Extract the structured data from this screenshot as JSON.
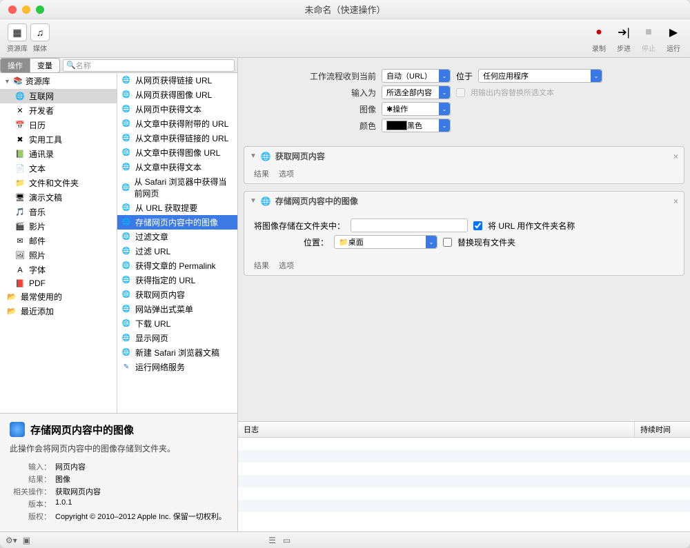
{
  "window": {
    "title": "未命名（快速操作）"
  },
  "toolbar": {
    "library": "资源库",
    "media": "媒体",
    "record": "录制",
    "step": "步进",
    "stop": "停止",
    "run": "运行"
  },
  "tabs": {
    "actions": "操作",
    "variables": "变量",
    "search_placeholder": "名称"
  },
  "library": {
    "root": "资源库",
    "categories": [
      {
        "label": "互联网",
        "icon": "🌐",
        "selected": true
      },
      {
        "label": "开发者",
        "icon": "✕"
      },
      {
        "label": "日历",
        "icon": "📅"
      },
      {
        "label": "实用工具",
        "icon": "✖"
      },
      {
        "label": "通讯录",
        "icon": "📗"
      },
      {
        "label": "文本",
        "icon": "📄"
      },
      {
        "label": "文件和文件夹",
        "icon": "📁"
      },
      {
        "label": "演示文稿",
        "icon": "🖥"
      },
      {
        "label": "音乐",
        "icon": "🎵"
      },
      {
        "label": "影片",
        "icon": "🎬"
      },
      {
        "label": "邮件",
        "icon": "✉"
      },
      {
        "label": "照片",
        "icon": "🖼"
      },
      {
        "label": "字体",
        "icon": "A"
      },
      {
        "label": "PDF",
        "icon": "📕"
      }
    ],
    "extras": [
      {
        "label": "最常使用的",
        "icon": "📂"
      },
      {
        "label": "最近添加",
        "icon": "📂"
      }
    ]
  },
  "actions": [
    "从网页获得链接 URL",
    "从网页获得图像 URL",
    "从网页中获得文本",
    "从文章中获得附带的 URL",
    "从文章中获得链接的 URL",
    "从文章中获得图像 URL",
    "从文章中获得文本",
    "从 Safari 浏览器中获得当前网页",
    "从 URL 获取提要",
    "存储网页内容中的图像",
    "过滤文章",
    "过滤 URL",
    "获得文章的 Permalink",
    "获得指定的 URL",
    "获取网页内容",
    "网站弹出式菜单",
    "下载 URL",
    "显示网页",
    "新建 Safari 浏览器文稿",
    "运行网络服务"
  ],
  "selected_action_index": 9,
  "detail": {
    "title": "存储网页内容中的图像",
    "description": "此操作会将网页内容中的图像存储到文件夹。",
    "kv": {
      "input_k": "输入：",
      "input_v": "网页内容",
      "result_k": "结果：",
      "result_v": "图像",
      "related_k": "相关操作：",
      "related_v": "获取网页内容",
      "version_k": "版本：",
      "version_v": "1.0.1",
      "copyright_k": "版权：",
      "copyright_v": "Copyright © 2010–2012 Apple Inc. 保留一切权利。"
    }
  },
  "config": {
    "workflow_receives": "工作流程收到当前",
    "workflow_receives_val": "自动（URL）",
    "located_in": "位于",
    "located_in_val": "任何应用程序",
    "input_as": "输入为",
    "input_as_val": "所选全部内容",
    "replace_label": "用输出内容替换所选文本",
    "image": "图像",
    "image_val": "操作",
    "color": "颜色",
    "color_val": "黑色"
  },
  "step1": {
    "title": "获取网页内容",
    "result": "结果",
    "options": "选项"
  },
  "step2": {
    "title": "存储网页内容中的图像",
    "save_in": "将图像存储在文件夹中：",
    "use_url_as_folder": "将 URL 用作文件夹名称",
    "location": "位置：",
    "location_val": "桌面",
    "replace_existing": "替换现有文件夹",
    "result": "结果",
    "options": "选项"
  },
  "log": {
    "col1": "日志",
    "col2": "持续时间"
  }
}
